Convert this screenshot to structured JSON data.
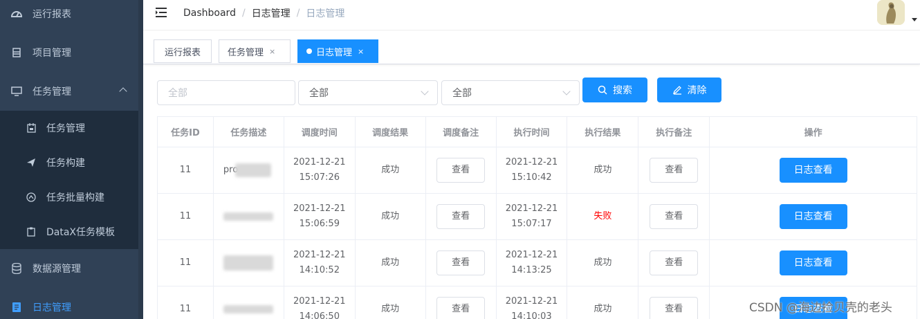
{
  "sidebar": {
    "items": [
      {
        "label": "运行报表",
        "icon": "dashboard-icon"
      },
      {
        "label": "项目管理",
        "icon": "project-icon"
      },
      {
        "label": "任务管理",
        "icon": "monitor-icon"
      },
      {
        "label": "数据源管理",
        "icon": "database-icon"
      },
      {
        "label": "日志管理",
        "icon": "log-icon"
      }
    ],
    "sub_items": [
      {
        "label": "任务管理",
        "icon": "calendar-icon"
      },
      {
        "label": "任务构建",
        "icon": "send-icon"
      },
      {
        "label": "任务批量构建",
        "icon": "batch-icon"
      },
      {
        "label": "DataX任务模板",
        "icon": "template-icon"
      }
    ]
  },
  "navbar": {
    "breadcrumb": [
      "Dashboard",
      "日志管理",
      "日志管理"
    ]
  },
  "tags": [
    {
      "label": "运行报表"
    },
    {
      "label": "任务管理",
      "close": "×"
    },
    {
      "label": "日志管理",
      "close": "×"
    }
  ],
  "filters": {
    "input_placeholder": "全部",
    "select1_value": "全部",
    "select2_value": "全部",
    "search_label": "搜索",
    "clear_label": "清除"
  },
  "table": {
    "headers": [
      "任务ID",
      "任务描述",
      "调度时间",
      "调度结果",
      "调度备注",
      "执行时间",
      "执行结果",
      "执行备注",
      "操作"
    ],
    "view_label": "查看",
    "log_label": "日志查看",
    "rows": [
      {
        "id": "11",
        "desc": "pro",
        "sched_date": "2021-12-21",
        "sched_time": "15:07:26",
        "sched_result": "成功",
        "exec_date": "2021-12-21",
        "exec_time": "15:10:42",
        "exec_result": "成功"
      },
      {
        "id": "11",
        "desc": "",
        "sched_date": "2021-12-21",
        "sched_time": "15:06:59",
        "sched_result": "成功",
        "exec_date": "2021-12-21",
        "exec_time": "15:07:17",
        "exec_result": "失败"
      },
      {
        "id": "11",
        "desc": "",
        "sched_date": "2021-12-21",
        "sched_time": "14:10:52",
        "sched_result": "成功",
        "exec_date": "2021-12-21",
        "exec_time": "14:13:25",
        "exec_result": "成功"
      },
      {
        "id": "11",
        "desc": "",
        "sched_date": "2021-12-21",
        "sched_time": "14:06:50",
        "sched_result": "成功",
        "exec_date": "2021-12-21",
        "exec_time": "14:10:03",
        "exec_result": "成功"
      }
    ]
  },
  "watermark": "CSDN @海边捡贝壳的老头",
  "colors": {
    "sidebar_bg": "#304156",
    "submenu_bg": "#1f2d3d",
    "primary": "#1890ff",
    "active_menu": "#409eff",
    "fail": "#ff0000"
  }
}
